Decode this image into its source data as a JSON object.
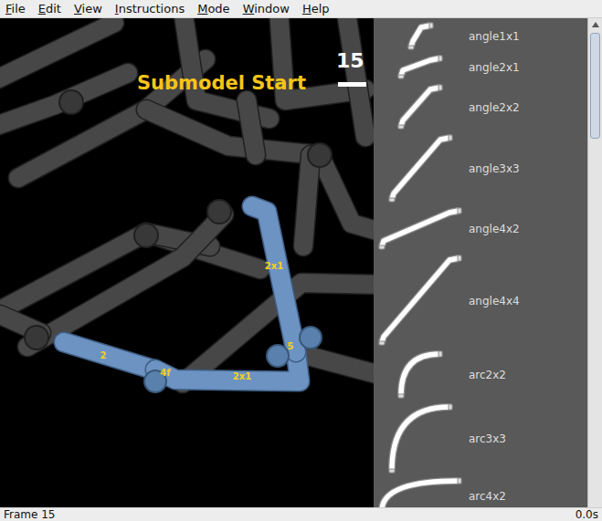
{
  "menu": [
    "File",
    "Edit",
    "View",
    "Instructions",
    "Mode",
    "Window",
    "Help"
  ],
  "viewport": {
    "overlay_title": "Submodel Start",
    "step": "15",
    "part_labels": [
      "2x1",
      "2",
      "4f",
      "2x1",
      "5"
    ]
  },
  "parts": [
    {
      "name": "angle1x1",
      "kind": "angle"
    },
    {
      "name": "angle2x1",
      "kind": "angle"
    },
    {
      "name": "angle2x2",
      "kind": "angle"
    },
    {
      "name": "angle3x3",
      "kind": "angle"
    },
    {
      "name": "angle4x2",
      "kind": "angle"
    },
    {
      "name": "angle4x4",
      "kind": "angle"
    },
    {
      "name": "arc2x2",
      "kind": "arc"
    },
    {
      "name": "arc3x3",
      "kind": "arc"
    },
    {
      "name": "arc4x2",
      "kind": "arc"
    }
  ],
  "scrollbar": {
    "level": 0.23
  },
  "status_bar": {
    "frame": "Frame 15",
    "time": "0.0s"
  }
}
